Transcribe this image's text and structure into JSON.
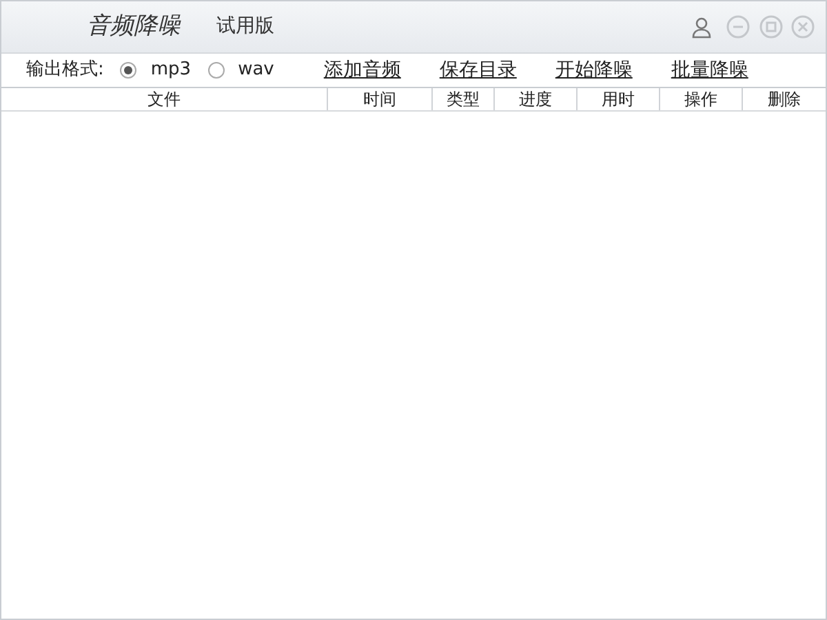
{
  "window": {
    "title": "音频降噪",
    "edition": "试用版"
  },
  "format": {
    "label": "输出格式:",
    "options": [
      {
        "label": "mp3",
        "selected": true
      },
      {
        "label": "wav",
        "selected": false
      }
    ]
  },
  "actions": [
    "添加音频",
    "保存目录",
    "开始降噪",
    "批量降噪"
  ],
  "table": {
    "columns": [
      {
        "label": "文件",
        "kind": "wide"
      },
      {
        "label": "时间",
        "kind": "time"
      },
      {
        "label": "类型",
        "kind": "narrow"
      },
      {
        "label": "进度",
        "kind": "mid"
      },
      {
        "label": "用时",
        "kind": "mid"
      },
      {
        "label": "操作",
        "kind": "mid"
      },
      {
        "label": "删除",
        "kind": "mid"
      }
    ]
  }
}
